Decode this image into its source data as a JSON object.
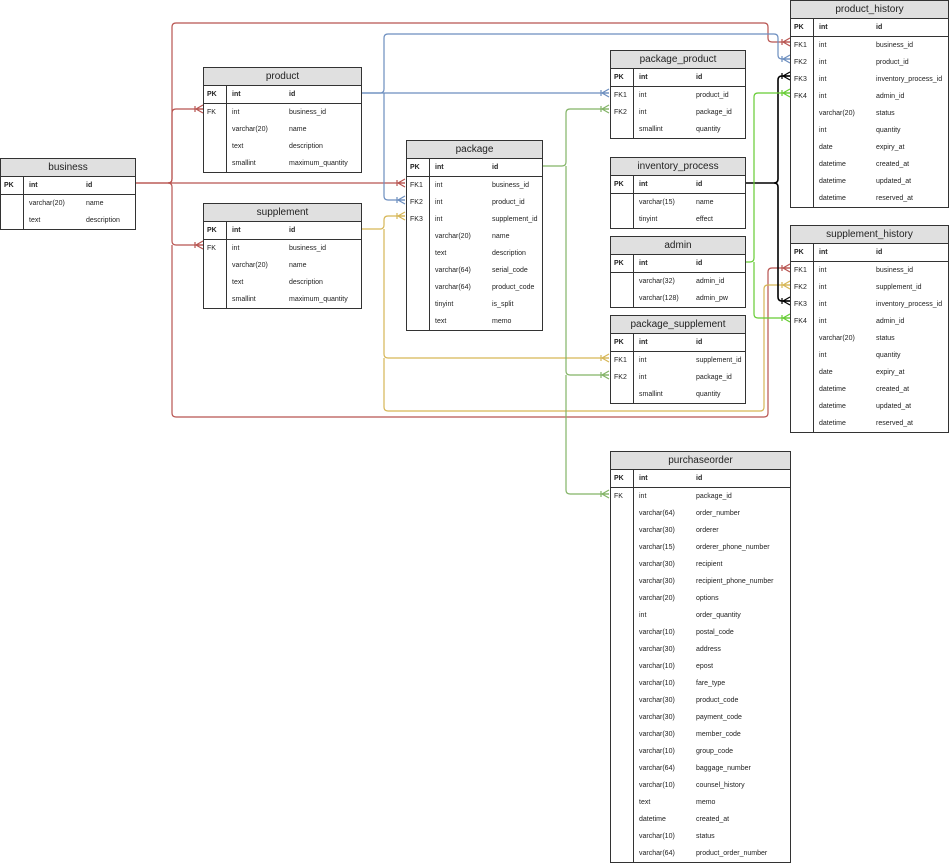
{
  "entities": {
    "business": {
      "title": "business",
      "rows": [
        [
          "PK",
          "int",
          "id"
        ],
        [
          "",
          "varchar(20)",
          "name"
        ],
        [
          "",
          "text",
          "description"
        ]
      ]
    },
    "product": {
      "title": "product",
      "rows": [
        [
          "PK",
          "int",
          "id"
        ],
        [
          "FK",
          "int",
          "business_id"
        ],
        [
          "",
          "varchar(20)",
          "name"
        ],
        [
          "",
          "text",
          "description"
        ],
        [
          "",
          "smallint",
          "maximum_quantity"
        ]
      ]
    },
    "supplement": {
      "title": "supplement",
      "rows": [
        [
          "PK",
          "int",
          "id"
        ],
        [
          "FK",
          "int",
          "business_id"
        ],
        [
          "",
          "varchar(20)",
          "name"
        ],
        [
          "",
          "text",
          "description"
        ],
        [
          "",
          "smallint",
          "maximum_quantity"
        ]
      ]
    },
    "package": {
      "title": "package",
      "rows": [
        [
          "PK",
          "int",
          "id"
        ],
        [
          "FK1",
          "int",
          "business_id"
        ],
        [
          "FK2",
          "int",
          "product_id"
        ],
        [
          "FK3",
          "int",
          "supplement_id"
        ],
        [
          "",
          "varchar(20)",
          "name"
        ],
        [
          "",
          "text",
          "description"
        ],
        [
          "",
          "varchar(64)",
          "serial_code"
        ],
        [
          "",
          "varchar(64)",
          "product_code"
        ],
        [
          "",
          "tinyint",
          "is_split"
        ],
        [
          "",
          "text",
          "memo"
        ]
      ]
    },
    "package_product": {
      "title": "package_product",
      "rows": [
        [
          "PK",
          "int",
          "id"
        ],
        [
          "FK1",
          "int",
          "product_id"
        ],
        [
          "FK2",
          "int",
          "package_id"
        ],
        [
          "",
          "smallint",
          "quantity"
        ]
      ]
    },
    "inventory_process": {
      "title": "inventory_process",
      "rows": [
        [
          "PK",
          "int",
          "id"
        ],
        [
          "",
          "varchar(15)",
          "name"
        ],
        [
          "",
          "tinyint",
          "effect"
        ]
      ]
    },
    "admin": {
      "title": "admin",
      "rows": [
        [
          "PK",
          "int",
          "id"
        ],
        [
          "",
          "varchar(32)",
          "admin_id"
        ],
        [
          "",
          "varchar(128)",
          "admin_pw"
        ]
      ]
    },
    "package_supplement": {
      "title": "package_supplement",
      "rows": [
        [
          "PK",
          "int",
          "id"
        ],
        [
          "FK1",
          "int",
          "supplement_id"
        ],
        [
          "FK2",
          "int",
          "package_id"
        ],
        [
          "",
          "smallint",
          "quantity"
        ]
      ]
    },
    "product_history": {
      "title": "product_history",
      "rows": [
        [
          "PK",
          "int",
          "id"
        ],
        [
          "FK1",
          "int",
          "business_id"
        ],
        [
          "FK2",
          "int",
          "product_id"
        ],
        [
          "FK3",
          "int",
          "inventory_process_id"
        ],
        [
          "FK4",
          "int",
          "admin_id"
        ],
        [
          "",
          "varchar(20)",
          "status"
        ],
        [
          "",
          "int",
          "quantity"
        ],
        [
          "",
          "date",
          "expiry_at"
        ],
        [
          "",
          "datetime",
          "created_at"
        ],
        [
          "",
          "datetime",
          "updated_at"
        ],
        [
          "",
          "datetime",
          "reserved_at"
        ]
      ]
    },
    "supplement_history": {
      "title": "supplement_history",
      "rows": [
        [
          "PK",
          "int",
          "id"
        ],
        [
          "FK1",
          "int",
          "business_id"
        ],
        [
          "FK2",
          "int",
          "supplement_id"
        ],
        [
          "FK3",
          "int",
          "inventory_process_id"
        ],
        [
          "FK4",
          "int",
          "admin_id"
        ],
        [
          "",
          "varchar(20)",
          "status"
        ],
        [
          "",
          "int",
          "quantity"
        ],
        [
          "",
          "date",
          "expiry_at"
        ],
        [
          "",
          "datetime",
          "created_at"
        ],
        [
          "",
          "datetime",
          "updated_at"
        ],
        [
          "",
          "datetime",
          "reserved_at"
        ]
      ]
    },
    "purchaseorder": {
      "title": "purchaseorder",
      "rows": [
        [
          "PK",
          "int",
          "id"
        ],
        [
          "FK",
          "int",
          "package_id"
        ],
        [
          "",
          "varchar(64)",
          "order_number"
        ],
        [
          "",
          "varchar(30)",
          "orderer"
        ],
        [
          "",
          "varchar(15)",
          "orderer_phone_number"
        ],
        [
          "",
          "varchar(30)",
          "recipient"
        ],
        [
          "",
          "varchar(30)",
          "recipient_phone_number"
        ],
        [
          "",
          "varchar(20)",
          "options"
        ],
        [
          "",
          "int",
          "order_quantity"
        ],
        [
          "",
          "varchar(10)",
          "postal_code"
        ],
        [
          "",
          "varchar(30)",
          "address"
        ],
        [
          "",
          "varchar(10)",
          "epost"
        ],
        [
          "",
          "varchar(10)",
          "fare_type"
        ],
        [
          "",
          "varchar(30)",
          "product_code"
        ],
        [
          "",
          "varchar(30)",
          "payment_code"
        ],
        [
          "",
          "varchar(30)",
          "member_code"
        ],
        [
          "",
          "varchar(10)",
          "group_code"
        ],
        [
          "",
          "varchar(64)",
          "baggage_number"
        ],
        [
          "",
          "varchar(10)",
          "counsel_history"
        ],
        [
          "",
          "text",
          "memo"
        ],
        [
          "",
          "datetime",
          "created_at"
        ],
        [
          "",
          "varchar(10)",
          "status"
        ],
        [
          "",
          "varchar(64)",
          "product_order_number"
        ]
      ]
    }
  },
  "colors": {
    "business": "#b85450",
    "product": "#6c8ebf",
    "supplement": "#d6b656",
    "package": "#82b366",
    "inventory_process": "#000000",
    "admin": "#66cc33"
  }
}
